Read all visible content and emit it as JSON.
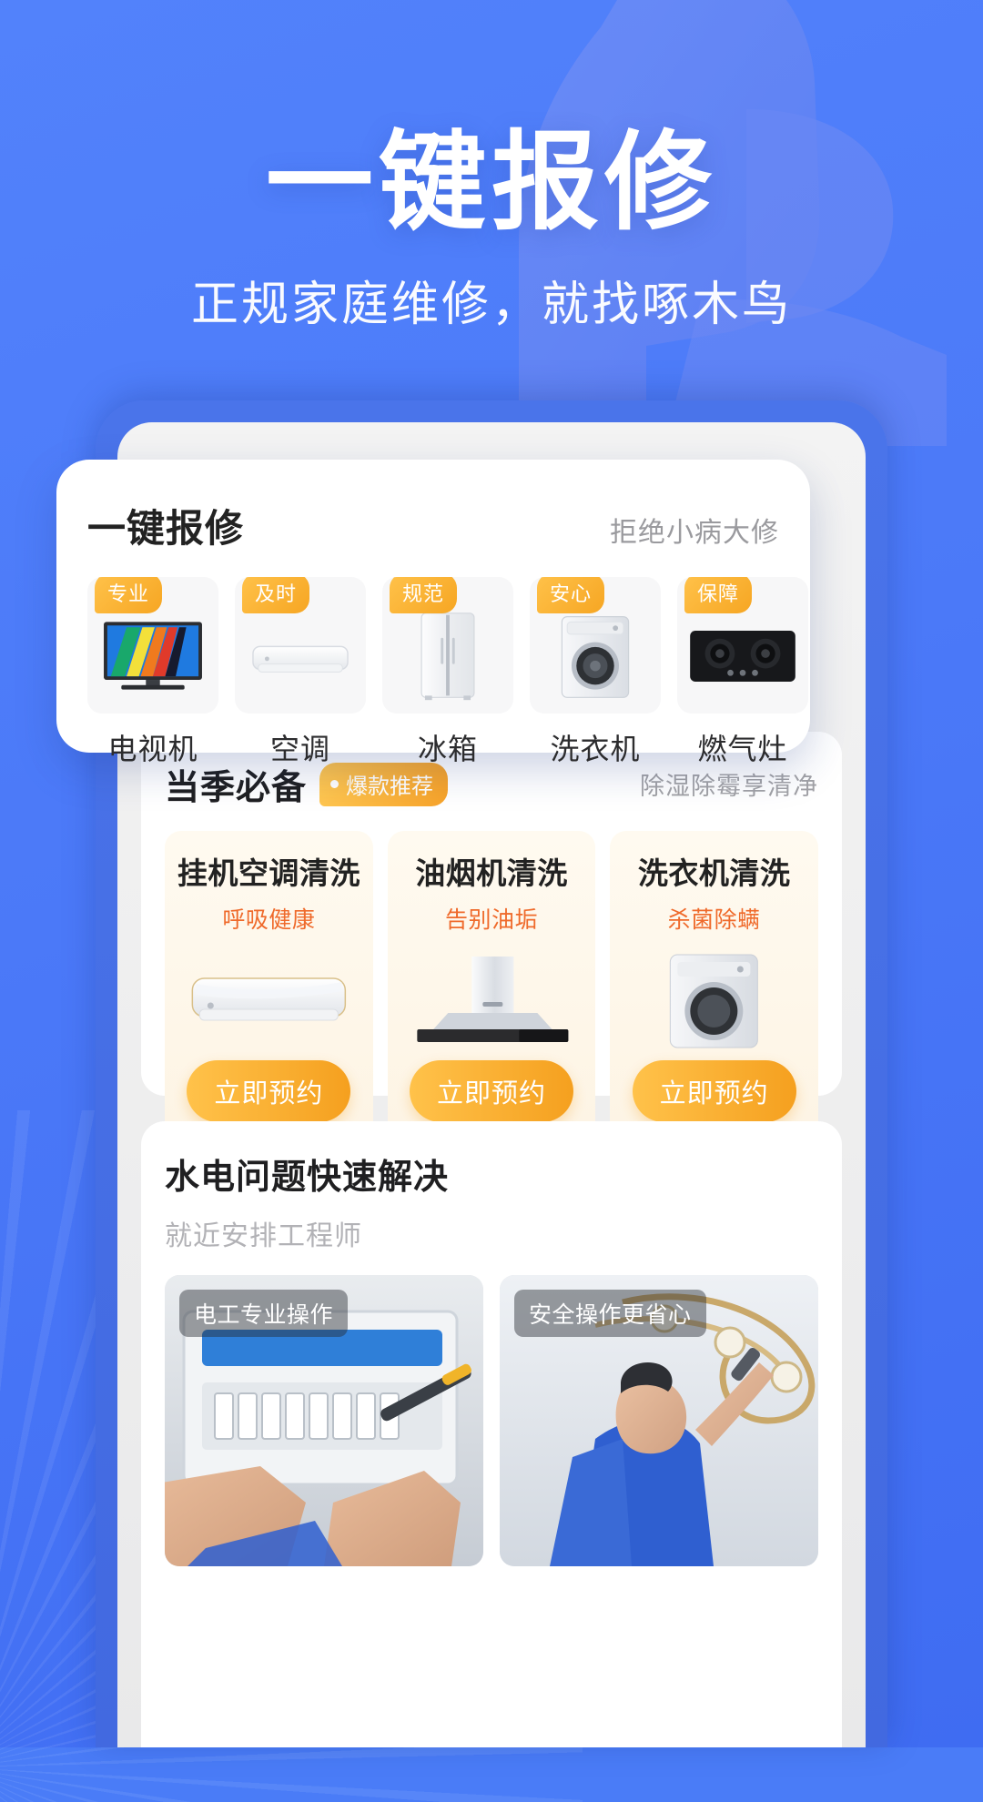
{
  "hero": {
    "title": "一键报修",
    "subtitle": "正规家庭维修，就找啄木鸟"
  },
  "repair_card": {
    "title": "一键报修",
    "note": "拒绝小病大修",
    "categories": [
      {
        "badge": "专业",
        "label": "电视机",
        "icon": "tv-icon"
      },
      {
        "badge": "及时",
        "label": "空调",
        "icon": "air-conditioner-icon"
      },
      {
        "badge": "规范",
        "label": "冰箱",
        "icon": "refrigerator-icon"
      },
      {
        "badge": "安心",
        "label": "洗衣机",
        "icon": "washing-machine-icon"
      },
      {
        "badge": "保障",
        "label": "燃气灶",
        "icon": "gas-stove-icon"
      }
    ]
  },
  "season_section": {
    "title": "当季必备",
    "hot_pill": "爆款推荐",
    "note": "除湿除霉享清净",
    "services": [
      {
        "title": "挂机空调清洗",
        "subtitle": "呼吸健康",
        "button": "立即预约",
        "icon": "wall-air-conditioner-icon"
      },
      {
        "title": "油烟机清洗",
        "subtitle": "告别油垢",
        "button": "立即预约",
        "icon": "range-hood-icon"
      },
      {
        "title": "洗衣机清洗",
        "subtitle": "杀菌除螨",
        "button": "立即预约",
        "icon": "washing-machine-icon"
      }
    ]
  },
  "electric_section": {
    "title": "水电问题快速解决",
    "subtitle": "就近安排工程师",
    "cards": [
      {
        "tag": "电工专业操作",
        "photo": "electrician-panel-photo"
      },
      {
        "tag": "安全操作更省心",
        "photo": "lamp-install-photo"
      }
    ]
  },
  "colors": {
    "brand_blue": "#4a7cf7",
    "accent_orange": "#f6a623",
    "highlight_red": "#ef6a2b",
    "card_white": "#ffffff"
  }
}
